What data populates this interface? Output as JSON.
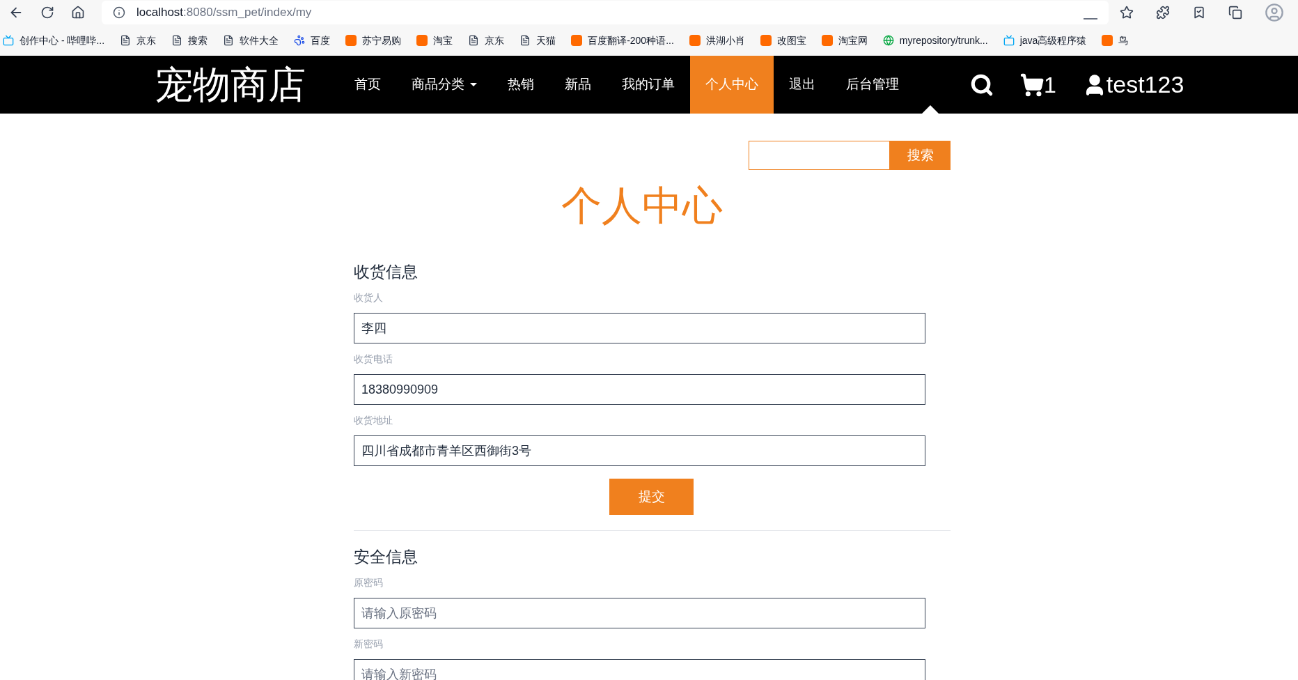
{
  "browser": {
    "url_host": "localhost",
    "url_rest": ":8080/ssm_pet/index/my"
  },
  "bookmarks": [
    {
      "label": "创作中心 - 哔哩哔...",
      "kind": "tv"
    },
    {
      "label": "京东",
      "kind": "page"
    },
    {
      "label": "搜索",
      "kind": "page"
    },
    {
      "label": "软件大全",
      "kind": "page"
    },
    {
      "label": "百度",
      "kind": "paw"
    },
    {
      "label": "苏宁易购",
      "kind": "site"
    },
    {
      "label": "淘宝",
      "kind": "site"
    },
    {
      "label": "京东",
      "kind": "page"
    },
    {
      "label": "天猫",
      "kind": "page"
    },
    {
      "label": "百度翻译-200种语...",
      "kind": "site"
    },
    {
      "label": "洪湖小肖",
      "kind": "site"
    },
    {
      "label": "改图宝",
      "kind": "site"
    },
    {
      "label": "淘宝网",
      "kind": "site"
    },
    {
      "label": "myrepository/trunk...",
      "kind": "globe"
    },
    {
      "label": "java高级程序猿",
      "kind": "tv"
    },
    {
      "label": "鸟",
      "kind": "site"
    }
  ],
  "navbar": {
    "logo": "宠物商店",
    "items": [
      {
        "label": "首页",
        "selected": false,
        "has_menu": false
      },
      {
        "label": "商品分类",
        "selected": false,
        "has_menu": true
      },
      {
        "label": "热销",
        "selected": false,
        "has_menu": false
      },
      {
        "label": "新品",
        "selected": false,
        "has_menu": false
      },
      {
        "label": "我的订单",
        "selected": false,
        "has_menu": false
      },
      {
        "label": "个人中心",
        "selected": true,
        "has_menu": false
      },
      {
        "label": "退出",
        "selected": false,
        "has_menu": false
      },
      {
        "label": "后台管理",
        "selected": false,
        "has_menu": false
      }
    ],
    "cart_count": "1",
    "username": "test123"
  },
  "search": {
    "button": "搜索"
  },
  "page_title": "个人中心",
  "sections": [
    {
      "heading": "收货信息",
      "fields": [
        {
          "label": "收货人",
          "value": "李四"
        },
        {
          "label": "收货电话",
          "value": "18380990909"
        },
        {
          "label": "收货地址",
          "value": "四川省成都市青羊区西御街3号"
        }
      ],
      "submit": "提交"
    },
    {
      "heading": "安全信息",
      "fields": [
        {
          "label": "原密码",
          "placeholder": "请输入原密码"
        },
        {
          "label": "新密码",
          "placeholder": "请输入新密码"
        }
      ]
    }
  ]
}
